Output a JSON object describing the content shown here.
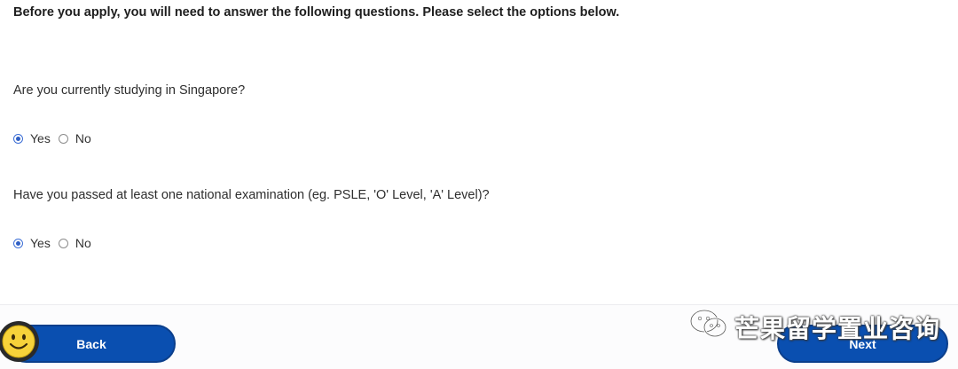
{
  "intro_text": "Before you apply, you will need to answer the following questions. Please select the options below.",
  "questions": [
    {
      "text": "Are you currently studying in Singapore?",
      "options": [
        {
          "label": "Yes",
          "selected": true
        },
        {
          "label": "No",
          "selected": false
        }
      ]
    },
    {
      "text": "Have you passed at least one national examination (eg. PSLE, 'O' Level, 'A' Level)?",
      "options": [
        {
          "label": "Yes",
          "selected": true
        },
        {
          "label": "No",
          "selected": false
        }
      ]
    }
  ],
  "footer": {
    "back_label": "Back",
    "next_label": "Next"
  },
  "watermark": {
    "text": "芒果留学置业咨询",
    "icon": "wechat-icon"
  },
  "overlay": {
    "icon": "smiley-face-icon"
  },
  "colors": {
    "button_bg": "#0a4fb0",
    "radio_selected": "#2f5fc4",
    "text": "#2e2e2e"
  }
}
